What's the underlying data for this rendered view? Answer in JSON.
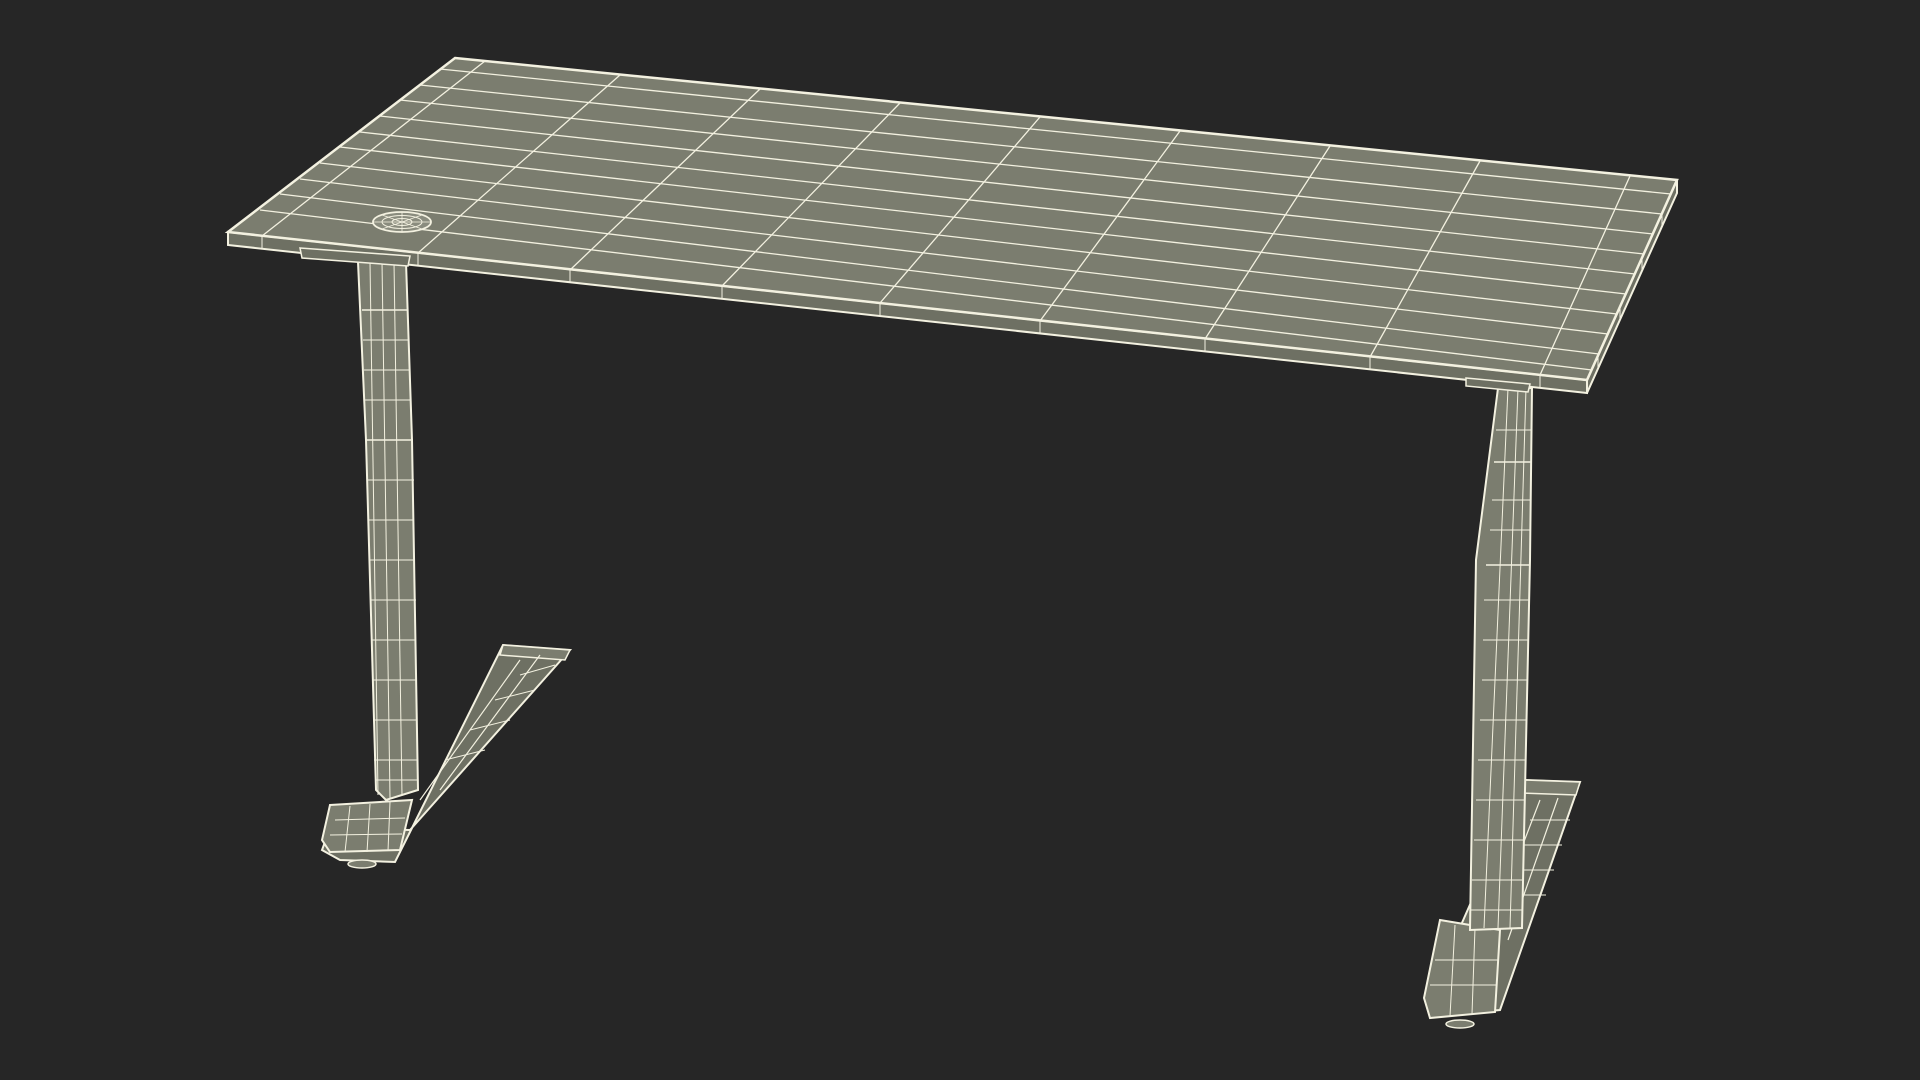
{
  "scene": {
    "subject": "standing-desk",
    "render_style": "wireframe",
    "colors": {
      "background": "#262626",
      "surface": "#7b7d6f",
      "surface_dark": "#6e7063",
      "wire": "#f3f1e0"
    }
  }
}
